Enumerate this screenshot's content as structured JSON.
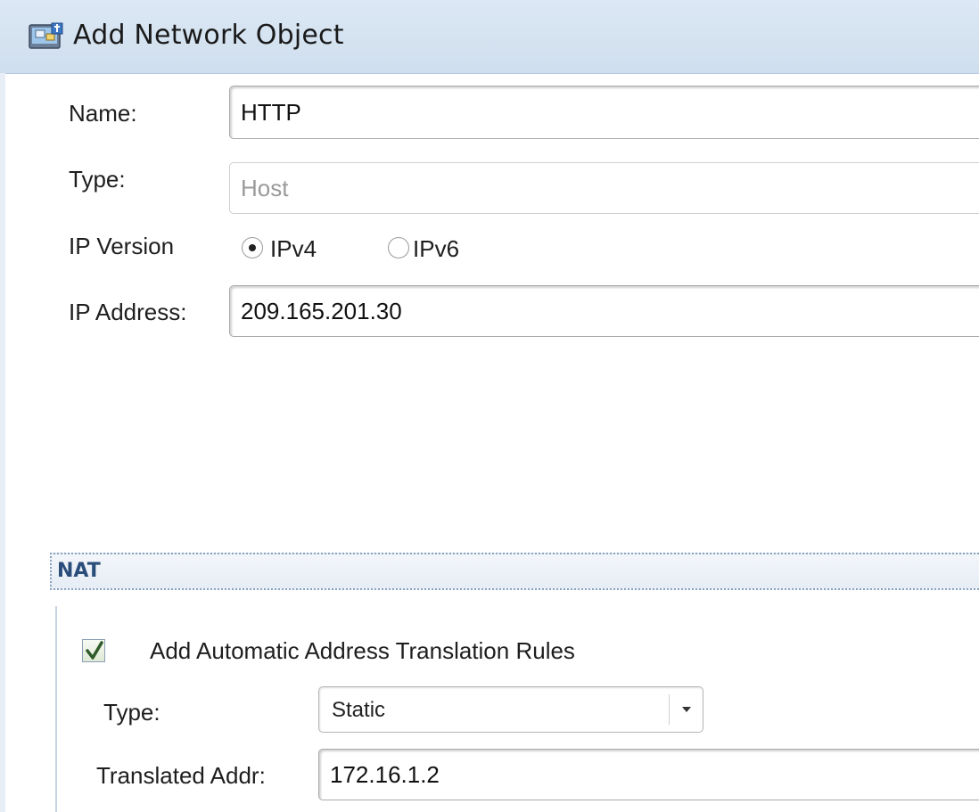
{
  "window": {
    "title": "Add Network Object"
  },
  "form": {
    "name_label": "Name:",
    "name_value": "HTTP",
    "type_label": "Type:",
    "type_value": "Host",
    "ip_version_label": "IP Version",
    "ipv4_label": "IPv4",
    "ipv6_label": "IPv6",
    "ip_version_selected": "IPv4",
    "ip_address_label": "IP Address:",
    "ip_address_value": "209.165.201.30"
  },
  "nat": {
    "section_title": "NAT",
    "auto_rules_label": "Add Automatic Address Translation Rules",
    "auto_rules_checked": true,
    "type_label": "Type:",
    "type_value": "Static",
    "translated_addr_label": "Translated Addr:",
    "translated_addr_value": "172.16.1.2"
  },
  "icons": {
    "app": "network-object-icon",
    "check": "checkmark-icon",
    "dropdown": "chevron-down-icon"
  }
}
